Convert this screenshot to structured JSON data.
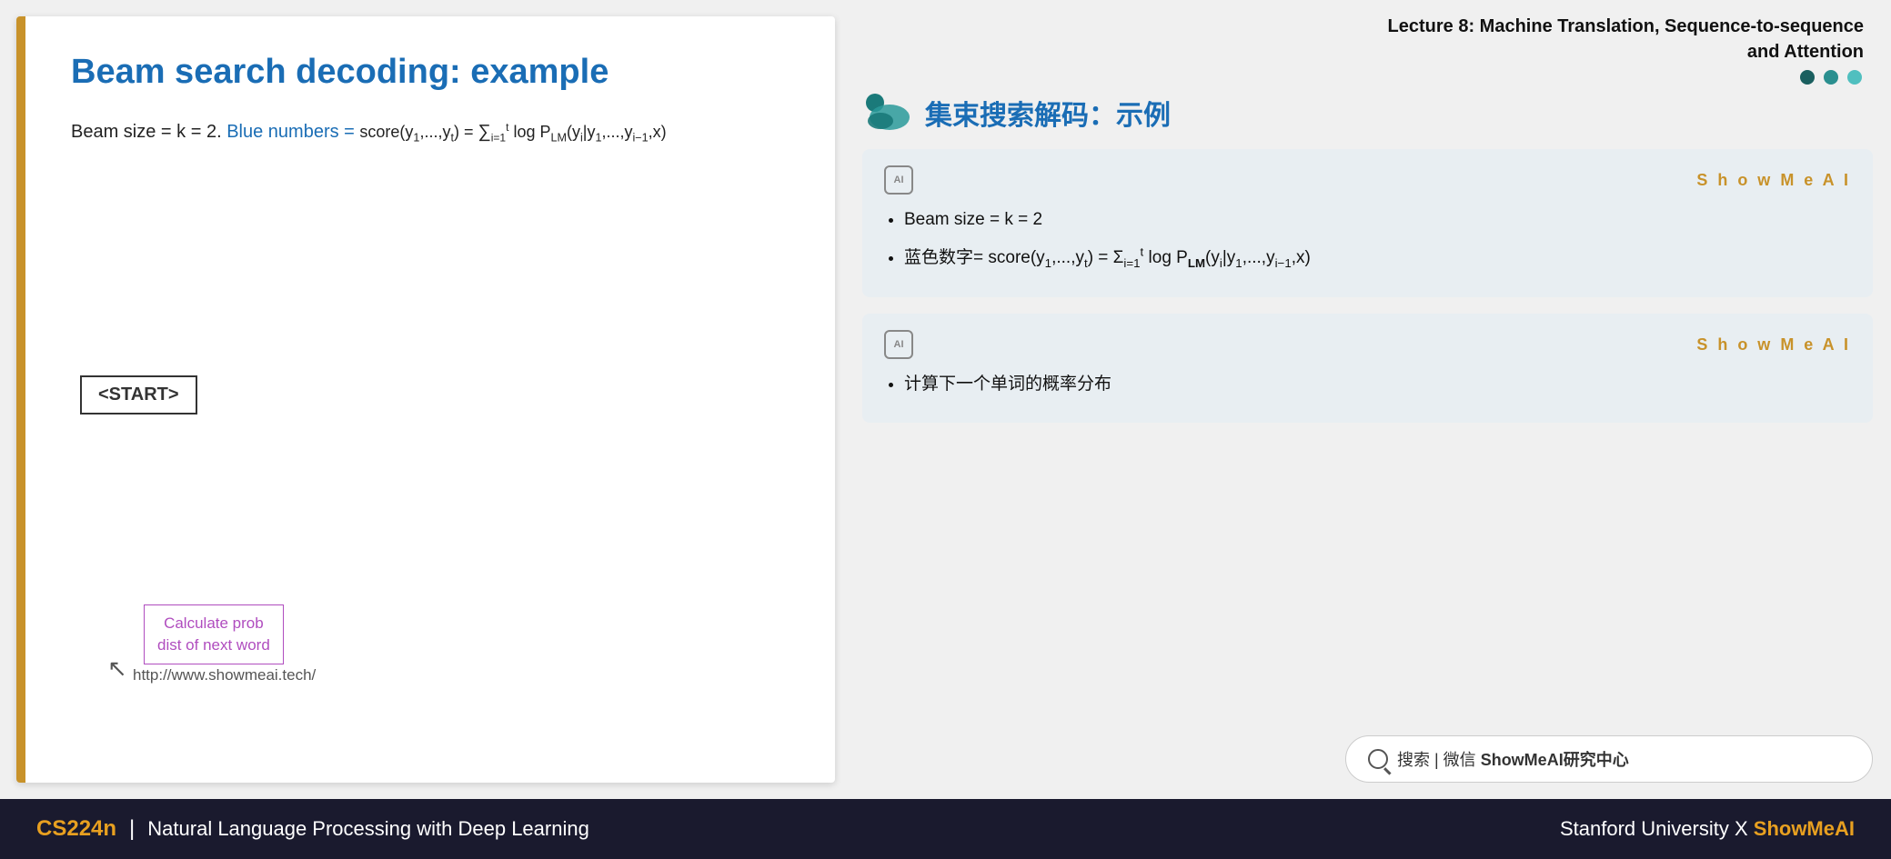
{
  "lecture": {
    "title_line1": "Lecture 8:  Machine Translation, Sequence-to-sequence",
    "title_line2": "and Attention"
  },
  "slide": {
    "title": "Beam search decoding: example",
    "subtitle_en": "Beam size = k = 2.",
    "blue_label": "Blue numbers =",
    "formula_text": "score(y₁,...,yₜ) = Σᵢ₌₁ᵗ log P_LM(yᵢ|y₁,...,yᵢ₋₁,x)",
    "start_label": "<START>",
    "tooltip_line1": "Calculate prob",
    "tooltip_line2": "dist of next word",
    "url": "http://www.showmeai.tech/"
  },
  "chinese_section": {
    "title": "集束搜索解码：示例",
    "card1": {
      "showmeai_label": "S h o w M e A I",
      "bullet1": "Beam size = k = 2",
      "bullet2_prefix": "蓝色数字= score(y₁,...,yₜ) = Σᵢ₌₁ᵗ log P_LM(yᵢ|y₁,...,yᵢ₋₁,x)"
    },
    "card2": {
      "showmeai_label": "S h o w M e A I",
      "bullet1": "计算下一个单词的概率分布"
    }
  },
  "search_bar": {
    "text": "搜索 | 微信 ShowMeAI研究中心"
  },
  "footer": {
    "cs224n": "CS224n",
    "subtitle": "Natural Language Processing with Deep Learning",
    "stanford": "Stanford University",
    "x": "X",
    "showmeai": "ShowMeAI"
  },
  "dots": {
    "dark": "#1a5f5f",
    "teal": "#2a8a8a",
    "light": "#4dbfbf"
  }
}
